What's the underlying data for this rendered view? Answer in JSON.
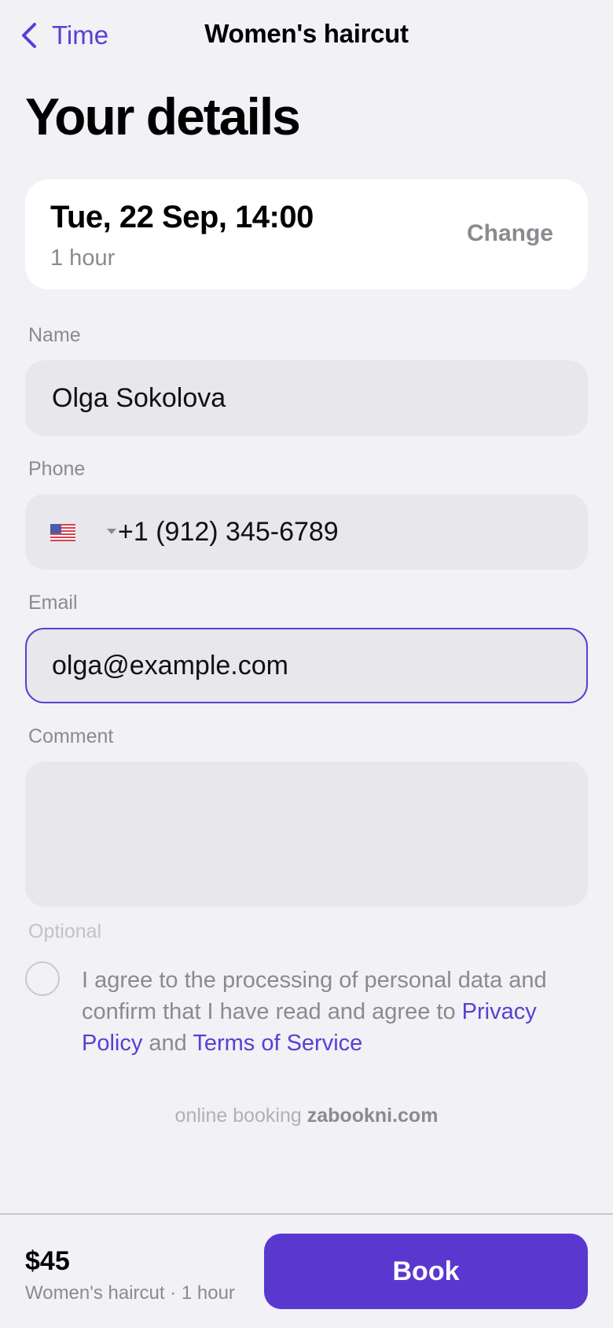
{
  "nav": {
    "back_label": "Time",
    "title": "Women's haircut"
  },
  "page_title": "Your details",
  "slot": {
    "date_time": "Tue, 22 Sep, 14:00",
    "duration": "1 hour",
    "change_label": "Change"
  },
  "form": {
    "name": {
      "label": "Name",
      "value": "Olga Sokolova"
    },
    "phone": {
      "label": "Phone",
      "country_icon": "us-flag-icon",
      "value": "+1 (912) 345-6789"
    },
    "email": {
      "label": "Email",
      "value": "olga@example.com",
      "focused": true
    },
    "comment": {
      "label": "Comment",
      "value": "",
      "hint": "Optional"
    }
  },
  "consent": {
    "checked": false,
    "text_before": "I agree to the processing of personal data and confirm that I have read and agree to ",
    "privacy_link": "Privacy Policy",
    "text_and": " and ",
    "terms_link": "Terms of Service"
  },
  "powered_by": {
    "prefix": "online booking ",
    "brand": "zabookni.com"
  },
  "footer": {
    "price": "$45",
    "summary": "Women's haircut · 1 hour",
    "book_label": "Book"
  },
  "colors": {
    "accent": "#5a3fd3",
    "button": "#5a38d0",
    "background": "#f1f1f6",
    "field": "#e7e7ec",
    "muted": "#8a8a8f"
  }
}
